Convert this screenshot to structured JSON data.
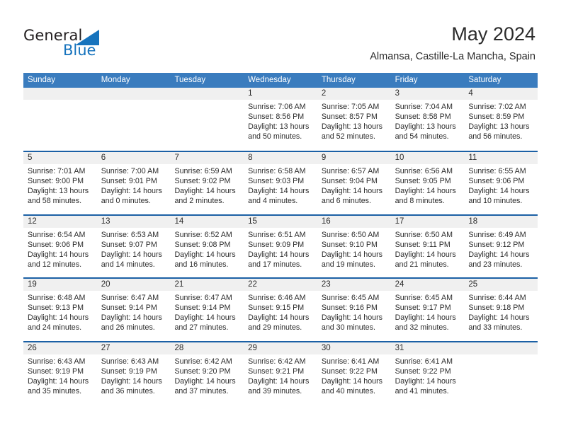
{
  "brand": {
    "name_top": "General",
    "name_bottom": "Blue",
    "flag_icon": "blue-flag-triangle-icon",
    "accent_color": "#1673bd"
  },
  "header": {
    "month_title": "May 2024",
    "location": "Almansa, Castille-La Mancha, Spain"
  },
  "colors": {
    "header_row_bg": "#3a7cbe",
    "week_divider": "#1b60a5",
    "day_band_bg": "#f0f0f0",
    "text": "#2b2b2b"
  },
  "calendar": {
    "day_names": [
      "Sunday",
      "Monday",
      "Tuesday",
      "Wednesday",
      "Thursday",
      "Friday",
      "Saturday"
    ],
    "weeks": [
      [
        {
          "day": "",
          "lines": []
        },
        {
          "day": "",
          "lines": []
        },
        {
          "day": "",
          "lines": []
        },
        {
          "day": "1",
          "lines": [
            "Sunrise: 7:06 AM",
            "Sunset: 8:56 PM",
            "Daylight: 13 hours",
            "and 50 minutes."
          ]
        },
        {
          "day": "2",
          "lines": [
            "Sunrise: 7:05 AM",
            "Sunset: 8:57 PM",
            "Daylight: 13 hours",
            "and 52 minutes."
          ]
        },
        {
          "day": "3",
          "lines": [
            "Sunrise: 7:04 AM",
            "Sunset: 8:58 PM",
            "Daylight: 13 hours",
            "and 54 minutes."
          ]
        },
        {
          "day": "4",
          "lines": [
            "Sunrise: 7:02 AM",
            "Sunset: 8:59 PM",
            "Daylight: 13 hours",
            "and 56 minutes."
          ]
        }
      ],
      [
        {
          "day": "5",
          "lines": [
            "Sunrise: 7:01 AM",
            "Sunset: 9:00 PM",
            "Daylight: 13 hours",
            "and 58 minutes."
          ]
        },
        {
          "day": "6",
          "lines": [
            "Sunrise: 7:00 AM",
            "Sunset: 9:01 PM",
            "Daylight: 14 hours",
            "and 0 minutes."
          ]
        },
        {
          "day": "7",
          "lines": [
            "Sunrise: 6:59 AM",
            "Sunset: 9:02 PM",
            "Daylight: 14 hours",
            "and 2 minutes."
          ]
        },
        {
          "day": "8",
          "lines": [
            "Sunrise: 6:58 AM",
            "Sunset: 9:03 PM",
            "Daylight: 14 hours",
            "and 4 minutes."
          ]
        },
        {
          "day": "9",
          "lines": [
            "Sunrise: 6:57 AM",
            "Sunset: 9:04 PM",
            "Daylight: 14 hours",
            "and 6 minutes."
          ]
        },
        {
          "day": "10",
          "lines": [
            "Sunrise: 6:56 AM",
            "Sunset: 9:05 PM",
            "Daylight: 14 hours",
            "and 8 minutes."
          ]
        },
        {
          "day": "11",
          "lines": [
            "Sunrise: 6:55 AM",
            "Sunset: 9:06 PM",
            "Daylight: 14 hours",
            "and 10 minutes."
          ]
        }
      ],
      [
        {
          "day": "12",
          "lines": [
            "Sunrise: 6:54 AM",
            "Sunset: 9:06 PM",
            "Daylight: 14 hours",
            "and 12 minutes."
          ]
        },
        {
          "day": "13",
          "lines": [
            "Sunrise: 6:53 AM",
            "Sunset: 9:07 PM",
            "Daylight: 14 hours",
            "and 14 minutes."
          ]
        },
        {
          "day": "14",
          "lines": [
            "Sunrise: 6:52 AM",
            "Sunset: 9:08 PM",
            "Daylight: 14 hours",
            "and 16 minutes."
          ]
        },
        {
          "day": "15",
          "lines": [
            "Sunrise: 6:51 AM",
            "Sunset: 9:09 PM",
            "Daylight: 14 hours",
            "and 17 minutes."
          ]
        },
        {
          "day": "16",
          "lines": [
            "Sunrise: 6:50 AM",
            "Sunset: 9:10 PM",
            "Daylight: 14 hours",
            "and 19 minutes."
          ]
        },
        {
          "day": "17",
          "lines": [
            "Sunrise: 6:50 AM",
            "Sunset: 9:11 PM",
            "Daylight: 14 hours",
            "and 21 minutes."
          ]
        },
        {
          "day": "18",
          "lines": [
            "Sunrise: 6:49 AM",
            "Sunset: 9:12 PM",
            "Daylight: 14 hours",
            "and 23 minutes."
          ]
        }
      ],
      [
        {
          "day": "19",
          "lines": [
            "Sunrise: 6:48 AM",
            "Sunset: 9:13 PM",
            "Daylight: 14 hours",
            "and 24 minutes."
          ]
        },
        {
          "day": "20",
          "lines": [
            "Sunrise: 6:47 AM",
            "Sunset: 9:14 PM",
            "Daylight: 14 hours",
            "and 26 minutes."
          ]
        },
        {
          "day": "21",
          "lines": [
            "Sunrise: 6:47 AM",
            "Sunset: 9:14 PM",
            "Daylight: 14 hours",
            "and 27 minutes."
          ]
        },
        {
          "day": "22",
          "lines": [
            "Sunrise: 6:46 AM",
            "Sunset: 9:15 PM",
            "Daylight: 14 hours",
            "and 29 minutes."
          ]
        },
        {
          "day": "23",
          "lines": [
            "Sunrise: 6:45 AM",
            "Sunset: 9:16 PM",
            "Daylight: 14 hours",
            "and 30 minutes."
          ]
        },
        {
          "day": "24",
          "lines": [
            "Sunrise: 6:45 AM",
            "Sunset: 9:17 PM",
            "Daylight: 14 hours",
            "and 32 minutes."
          ]
        },
        {
          "day": "25",
          "lines": [
            "Sunrise: 6:44 AM",
            "Sunset: 9:18 PM",
            "Daylight: 14 hours",
            "and 33 minutes."
          ]
        }
      ],
      [
        {
          "day": "26",
          "lines": [
            "Sunrise: 6:43 AM",
            "Sunset: 9:19 PM",
            "Daylight: 14 hours",
            "and 35 minutes."
          ]
        },
        {
          "day": "27",
          "lines": [
            "Sunrise: 6:43 AM",
            "Sunset: 9:19 PM",
            "Daylight: 14 hours",
            "and 36 minutes."
          ]
        },
        {
          "day": "28",
          "lines": [
            "Sunrise: 6:42 AM",
            "Sunset: 9:20 PM",
            "Daylight: 14 hours",
            "and 37 minutes."
          ]
        },
        {
          "day": "29",
          "lines": [
            "Sunrise: 6:42 AM",
            "Sunset: 9:21 PM",
            "Daylight: 14 hours",
            "and 39 minutes."
          ]
        },
        {
          "day": "30",
          "lines": [
            "Sunrise: 6:41 AM",
            "Sunset: 9:22 PM",
            "Daylight: 14 hours",
            "and 40 minutes."
          ]
        },
        {
          "day": "31",
          "lines": [
            "Sunrise: 6:41 AM",
            "Sunset: 9:22 PM",
            "Daylight: 14 hours",
            "and 41 minutes."
          ]
        },
        {
          "day": "",
          "lines": []
        }
      ]
    ]
  }
}
